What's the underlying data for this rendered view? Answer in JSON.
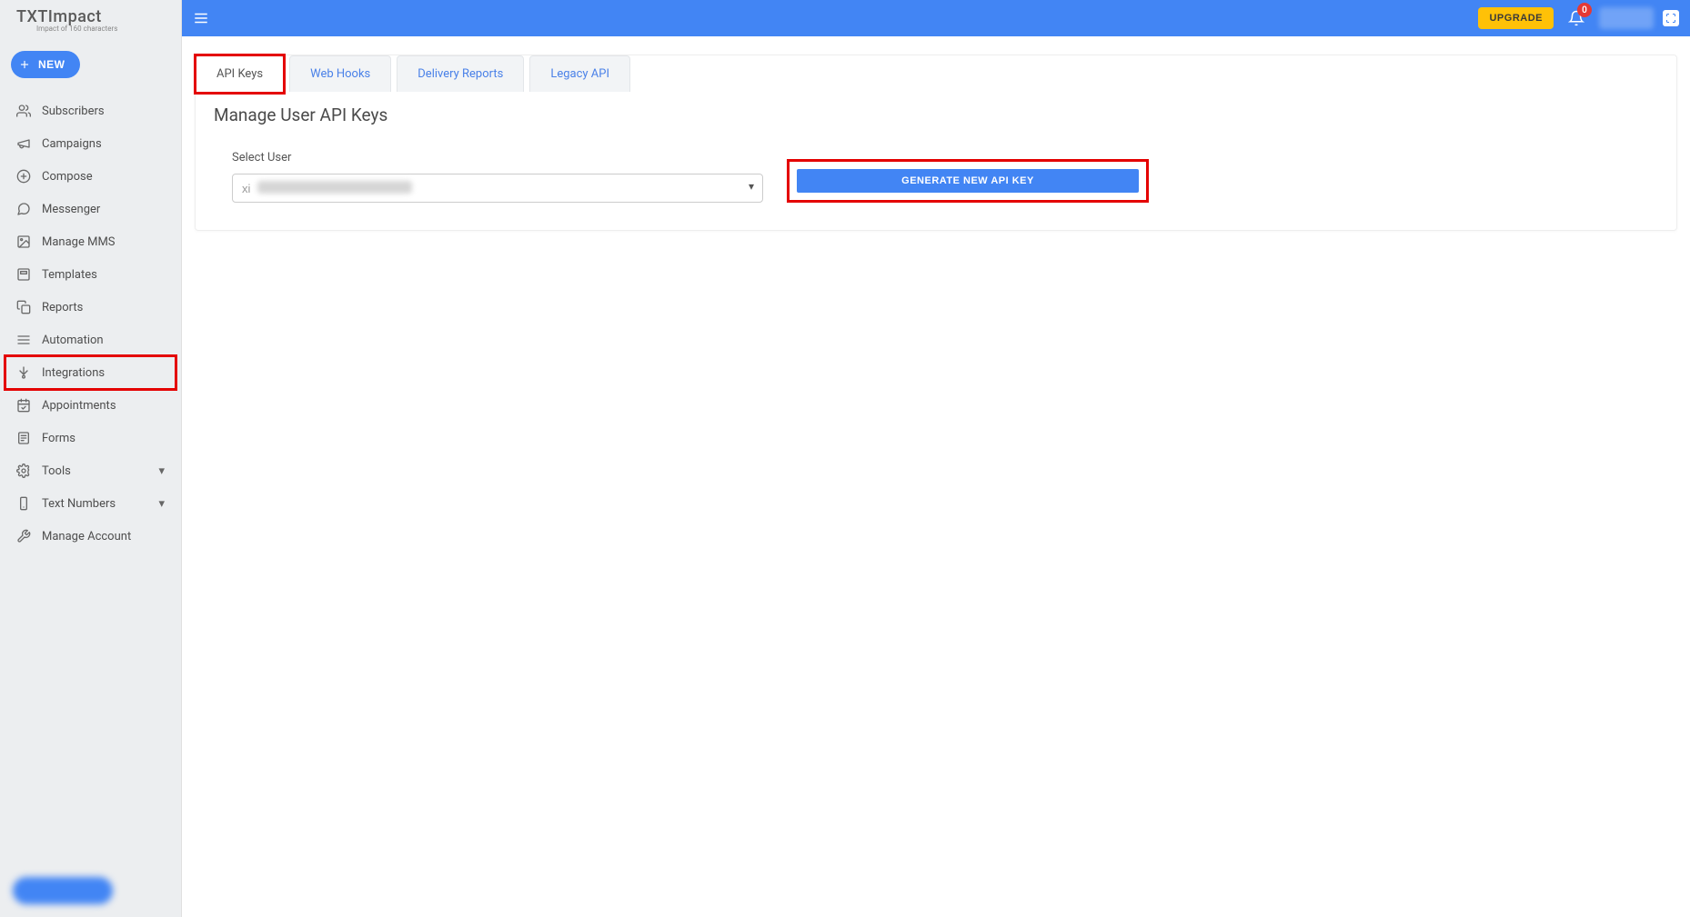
{
  "brand": {
    "name": "TXTImpact",
    "tagline": "Impact of 160 characters"
  },
  "sidebar": {
    "new_label": "NEW",
    "items": [
      {
        "label": "Subscribers",
        "icon": "users"
      },
      {
        "label": "Campaigns",
        "icon": "megaphone"
      },
      {
        "label": "Compose",
        "icon": "compose"
      },
      {
        "label": "Messenger",
        "icon": "chat"
      },
      {
        "label": "Manage MMS",
        "icon": "image"
      },
      {
        "label": "Templates",
        "icon": "template"
      },
      {
        "label": "Reports",
        "icon": "copy"
      },
      {
        "label": "Automation",
        "icon": "stack"
      },
      {
        "label": "Integrations",
        "icon": "plug",
        "highlight": true
      },
      {
        "label": "Appointments",
        "icon": "calendar-check"
      },
      {
        "label": "Forms",
        "icon": "form"
      },
      {
        "label": "Tools",
        "icon": "gear",
        "expandable": true
      },
      {
        "label": "Text Numbers",
        "icon": "phone",
        "expandable": true
      },
      {
        "label": "Manage Account",
        "icon": "wrench"
      }
    ]
  },
  "topbar": {
    "upgrade_label": "UPGRADE",
    "notification_count": "0"
  },
  "tabs": [
    {
      "label": "API Keys",
      "active": true,
      "highlight": true
    },
    {
      "label": "Web Hooks"
    },
    {
      "label": "Delivery Reports"
    },
    {
      "label": "Legacy API"
    }
  ],
  "panel": {
    "title": "Manage User API Keys",
    "select_label": "Select User",
    "selected_user_prefix": "xi",
    "generate_label": "GENERATE NEW API KEY"
  }
}
